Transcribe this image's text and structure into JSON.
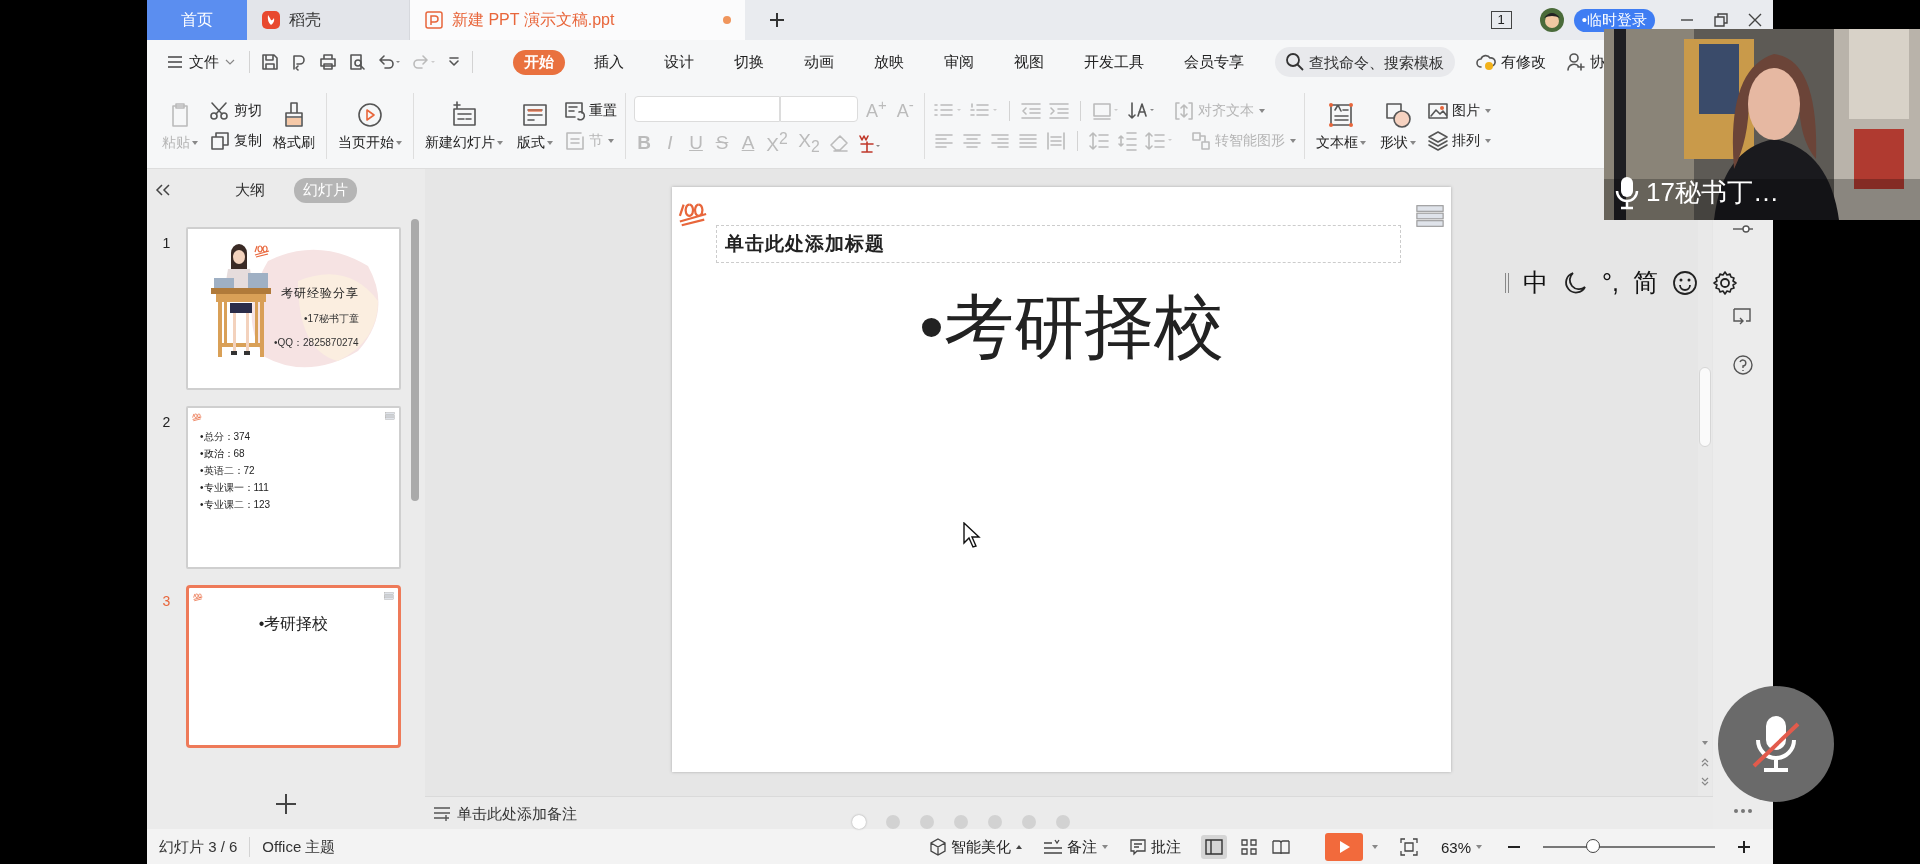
{
  "tab_bar": {
    "tabs": [
      {
        "label": "首页",
        "kind": "home",
        "selected": false
      },
      {
        "label": "稻壳",
        "kind": "docer",
        "selected": false
      },
      {
        "label": "新建 PPT 演示文稿.ppt",
        "kind": "document",
        "selected": true,
        "unsaved": true
      }
    ],
    "page_count": "1",
    "login": "•临时登录"
  },
  "menu_bar": {
    "file": "文件",
    "tabs": [
      {
        "label": "开始",
        "selected": true
      },
      {
        "label": "插入",
        "selected": false
      },
      {
        "label": "设计",
        "selected": false
      },
      {
        "label": "切换",
        "selected": false
      },
      {
        "label": "动画",
        "selected": false
      },
      {
        "label": "放映",
        "selected": false
      },
      {
        "label": "审阅",
        "selected": false
      },
      {
        "label": "视图",
        "selected": false
      },
      {
        "label": "开发工具",
        "selected": false
      },
      {
        "label": "会员专享",
        "selected": false
      }
    ],
    "search": {
      "placeholder": "查找命令、搜索模板"
    },
    "changes": "有修改",
    "collaborate": "协"
  },
  "ribbon": {
    "paste": {
      "label": "粘贴",
      "disabled": true
    },
    "cut": {
      "label": "剪切",
      "disabled": false
    },
    "copy": {
      "label": "复制",
      "disabled": false
    },
    "format_painter": {
      "label": "格式刷",
      "disabled": false
    },
    "play_from_current": {
      "label": "当页开始",
      "disabled": false
    },
    "new_slide": {
      "label": "新建幻灯片",
      "disabled": false
    },
    "layout": {
      "label": "版式",
      "disabled": false
    },
    "reset": {
      "label": "重置",
      "disabled": false
    },
    "section": {
      "label": "节",
      "disabled": true
    },
    "font_size_buttons": [
      "A$^{+}$",
      "A$^{-}$"
    ],
    "font_styles": [
      "B",
      "I",
      "U",
      "S",
      "A",
      "X$^{2}$",
      "X$_{2}$"
    ],
    "align_text": {
      "label": "对齐文本",
      "disabled": true
    },
    "smart_art": {
      "label": "转智能图形",
      "disabled": true
    },
    "text_box": {
      "label": "文本框",
      "disabled": false
    },
    "shape": {
      "label": "形状",
      "disabled": false
    },
    "picture": {
      "label": "图片",
      "disabled": false
    },
    "arrange": {
      "label": "排列",
      "disabled": false
    }
  },
  "panel": {
    "tabs": [
      {
        "label": "大纲",
        "selected": false
      },
      {
        "label": "幻灯片",
        "selected": true
      }
    ],
    "slides": [
      {
        "number": "1",
        "kind": "cover",
        "selected": false,
        "title": "考研经验分享",
        "lines": [
          "•17秘书丁童",
          "•QQ：2825870274"
        ]
      },
      {
        "number": "2",
        "kind": "list",
        "selected": false,
        "lines": [
          "•总分：374",
          "•政治：68",
          "•英语二：72",
          "•专业课一：111",
          "•专业课二：123"
        ]
      },
      {
        "number": "3",
        "kind": "heading",
        "selected": true,
        "text": "•考研择校"
      }
    ]
  },
  "slide": {
    "title_placeholder": "单击此处添加标题",
    "body": "•考研择校"
  },
  "notes": {
    "placeholder": "单击此处添加备注"
  },
  "page_dots": [
    {
      "selected": true
    },
    {
      "selected": false
    },
    {
      "selected": false
    },
    {
      "selected": false
    },
    {
      "selected": false
    },
    {
      "selected": false
    },
    {
      "selected": false
    }
  ],
  "status_bar": {
    "slide": "幻灯片 3 / 6",
    "theme": "Office 主题",
    "beautify": "智能美化",
    "notes": "备注",
    "comments": "批注",
    "zoom": "63%",
    "zoom_slider": {
      "level": 0.29
    }
  },
  "ime_bar": {
    "mode": "中",
    "punctuation": "°,",
    "script": "简"
  },
  "video": {
    "kind": "picture",
    "caption": "17秘书丁…"
  },
  "mic": {
    "muted": true
  }
}
